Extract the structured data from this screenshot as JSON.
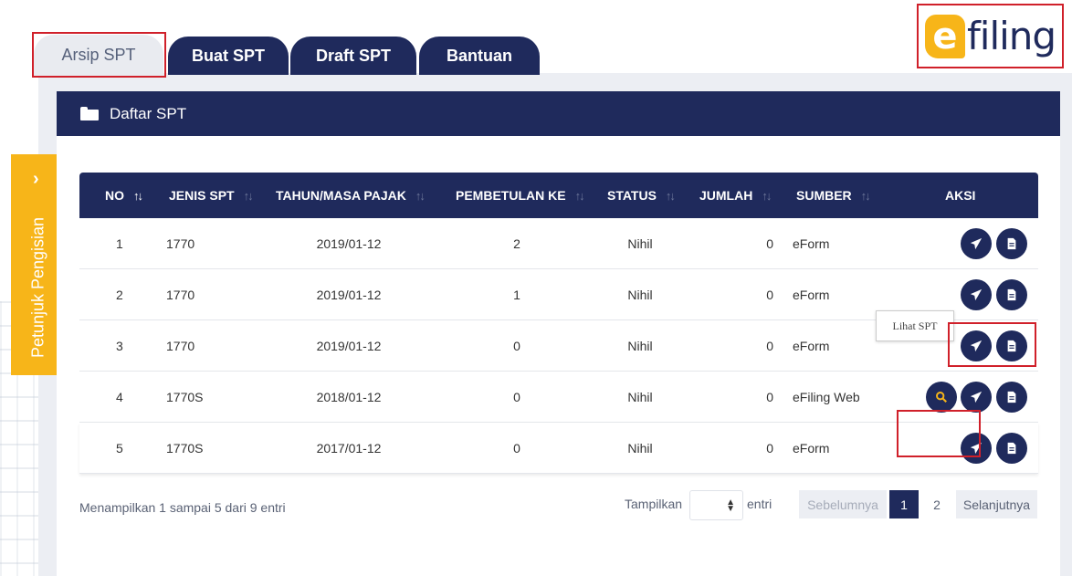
{
  "tabs": [
    {
      "label": "Arsip SPT",
      "active": true
    },
    {
      "label": "Buat SPT",
      "active": false
    },
    {
      "label": "Draft SPT",
      "active": false
    },
    {
      "label": "Bantuan",
      "active": false
    }
  ],
  "logo": {
    "e": "e",
    "text": "filing"
  },
  "side_tab": {
    "label": "Petunjuk Pengisian"
  },
  "card": {
    "title": "Daftar SPT"
  },
  "table": {
    "headers": [
      "NO",
      "JENIS SPT",
      "TAHUN/MASA PAJAK",
      "PEMBETULAN KE",
      "STATUS",
      "JUMLAH",
      "SUMBER",
      "AKSI"
    ],
    "rows": [
      {
        "no": "1",
        "jenis": "1770",
        "tahun": "2019/01-12",
        "pembetulan": "2",
        "status": "Nihil",
        "jumlah": "0",
        "sumber": "eForm"
      },
      {
        "no": "2",
        "jenis": "1770",
        "tahun": "2019/01-12",
        "pembetulan": "1",
        "status": "Nihil",
        "jumlah": "0",
        "sumber": "eForm"
      },
      {
        "no": "3",
        "jenis": "1770",
        "tahun": "2019/01-12",
        "pembetulan": "0",
        "status": "Nihil",
        "jumlah": "0",
        "sumber": "eForm"
      },
      {
        "no": "4",
        "jenis": "1770S",
        "tahun": "2018/01-12",
        "pembetulan": "0",
        "status": "Nihil",
        "jumlah": "0",
        "sumber": "eFiling Web"
      },
      {
        "no": "5",
        "jenis": "1770S",
        "tahun": "2017/01-12",
        "pembetulan": "0",
        "status": "Nihil",
        "jumlah": "0",
        "sumber": "eForm"
      }
    ]
  },
  "tooltip": {
    "text": "Lihat SPT"
  },
  "footer": {
    "info": "Menampilkan 1 sampai 5 dari 9 entri",
    "length_label": "Tampilkan",
    "length_suffix": "entri",
    "prev": "Sebelumnya",
    "pages": [
      "1",
      "2"
    ],
    "next": "Selanjutnya"
  },
  "colors": {
    "navy": "#1f2a5c",
    "yellow": "#f7b519",
    "highlight": "#d0202a"
  },
  "icons": {
    "send": "paper-plane-icon",
    "doc": "document-icon",
    "view": "search-icon",
    "folder": "folder-icon"
  }
}
